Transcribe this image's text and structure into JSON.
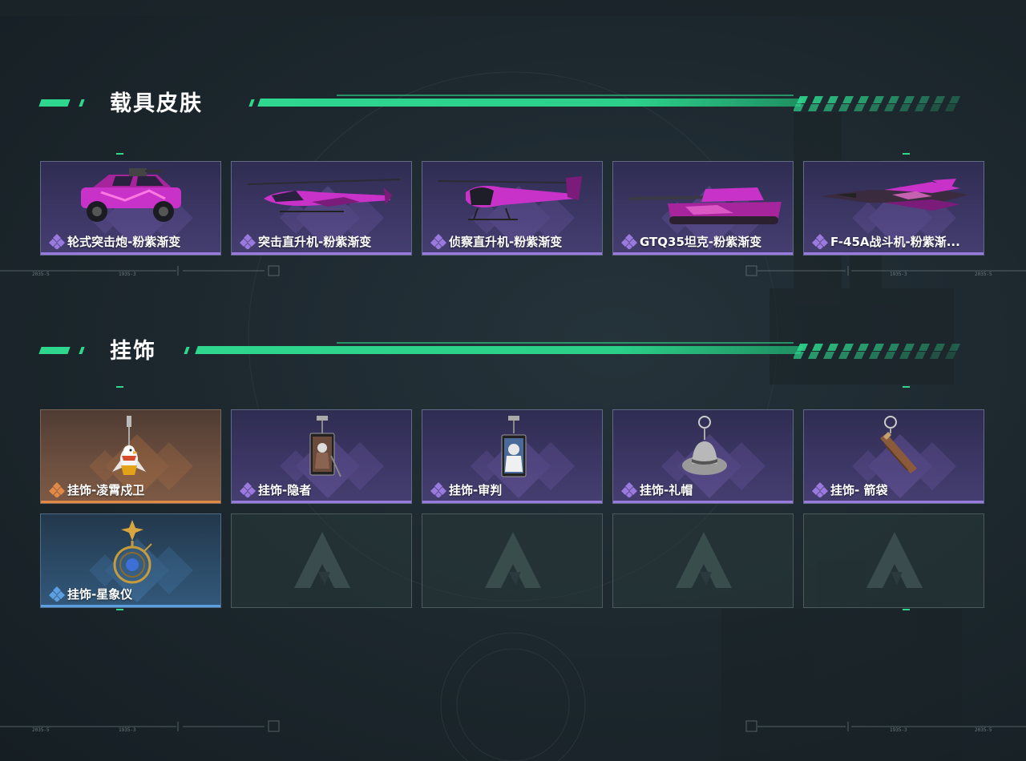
{
  "sections": [
    {
      "title": "载具皮肤",
      "items": [
        {
          "name": "轮式突击炮-粉紫渐变",
          "rarity": "purple",
          "icon": "armored-car-art"
        },
        {
          "name": "突击直升机-粉紫渐变",
          "rarity": "purple",
          "icon": "attack-helicopter-art"
        },
        {
          "name": "侦察直升机-粉紫渐变",
          "rarity": "purple",
          "icon": "scout-helicopter-art"
        },
        {
          "name": "GTQ35坦克-粉紫渐变",
          "rarity": "purple",
          "icon": "tank-art"
        },
        {
          "name": "F-45A战斗机-粉紫渐...",
          "rarity": "purple",
          "icon": "fighter-jet-art"
        }
      ]
    },
    {
      "title": "挂饰",
      "items": [
        {
          "name": "挂饰-凌霄戍卫",
          "rarity": "orange",
          "icon": "eagle-charm-art"
        },
        {
          "name": "挂饰-隐者",
          "rarity": "purple",
          "icon": "hermit-card-charm-art"
        },
        {
          "name": "挂饰-审判",
          "rarity": "purple",
          "icon": "judgement-card-charm-art"
        },
        {
          "name": "挂饰-礼帽",
          "rarity": "purple",
          "icon": "hat-charm-art"
        },
        {
          "name": "挂饰- 箭袋",
          "rarity": "purple",
          "icon": "quiver-charm-art"
        },
        {
          "name": "挂饰-星象仪",
          "rarity": "blue",
          "icon": "astrolabe-charm-art"
        }
      ],
      "empty_slots": 4
    }
  ],
  "hud_marks": {
    "left": "2035-5",
    "left2": "1935-3",
    "right": "1935-3",
    "right2": "2035-5"
  },
  "colors": {
    "accent": "#2fd78e",
    "rarity_purple": "#9b7ae0",
    "rarity_orange": "#e28a45",
    "rarity_blue": "#5b9fe0",
    "pink_magenta": "#c832c8"
  }
}
